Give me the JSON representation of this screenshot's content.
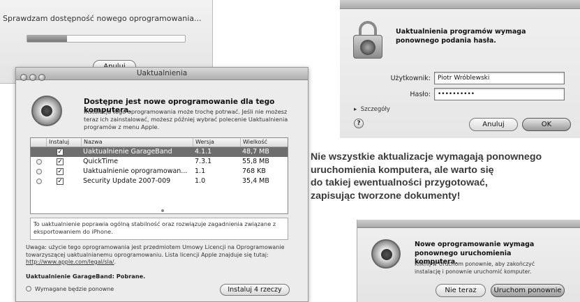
{
  "checking": {
    "message": "Sprawdzam dostępność nowego oprogramowania...",
    "progress": 0.25,
    "cancel_label": "Anuluj"
  },
  "updates": {
    "window_title": "Uaktualnienia",
    "heading": "Dostępne jest nowe oprogramowanie dla tego komputera.",
    "subtext": "Instalacja tego oprogramowania może trochę potrwać. Jeśli nie możesz teraz ich zainstalować, możesz później wybrać polecenie Uaktualnienia programów z menu Apple.",
    "columns": {
      "install": "Instaluj",
      "name": "Nazwa",
      "version": "Wersja",
      "size": "Wielkość"
    },
    "rows": [
      {
        "name": "Uaktualnienie GarageBand",
        "version": "4.1.1",
        "size": "48,7 MB",
        "checked": "✓",
        "selected": true
      },
      {
        "name": "QuickTime",
        "version": "7.3.1",
        "size": "55,8 MB",
        "checked": "✓",
        "selected": false
      },
      {
        "name": "Uaktualnienie oprogramowan...",
        "version": "1.1",
        "size": "768 KB",
        "checked": "✓",
        "selected": false
      },
      {
        "name": "Security Update 2007-009",
        "version": "1.0",
        "size": "35,4 MB",
        "checked": "✓",
        "selected": false
      }
    ],
    "description": "To uaktualnienie poprawia ogólną stabilność oraz rozwiązuje zagadnienia związane z eksportowaniem do iPhone.",
    "license_text": "Uwaga: użycie tego oprogramowania jest przedmiotem Umowy Licencji na Oprogramowanie towarzyszącej uaktualnianemu oprogramowaniu. Lista licencji Apple znajduje się tutaj:",
    "license_link": "http://www.apple.com/legal/sla/",
    "downloaded": "Uaktualnienie GarageBand: Pobrane.",
    "restart_required": "Wymagane będzie ponowne",
    "install_label": "Instaluj 4 rzeczy"
  },
  "password": {
    "title": "Uaktualnienia programów wymaga ponownego podania hasła.",
    "user_label": "Użytkownik:",
    "user_value": "Piotr Wróblewski",
    "pass_label": "Hasło:",
    "pass_value": "••••••••••",
    "details_label": "Szczegóły",
    "help_label": "?",
    "cancel_label": "Anuluj",
    "ok_label": "OK"
  },
  "caption": {
    "line1": "Nie wszystkie aktualizacje wymagają ponownego",
    "line2": "uruchomienia komputera, ale warto się",
    "line3": "do takiej ewentualności przygotować,",
    "line4": "zapisując tworzone dokumenty!"
  },
  "restart": {
    "title": "Nowe oprogramowanie wymaga ponownego uruchomienia komputera.",
    "body": "Kliknij w Uruchom ponownie, aby zakończyć instalację i ponownie uruchomić komputer.",
    "later_label": "Nie teraz",
    "restart_label": "Uruchom ponownie"
  }
}
